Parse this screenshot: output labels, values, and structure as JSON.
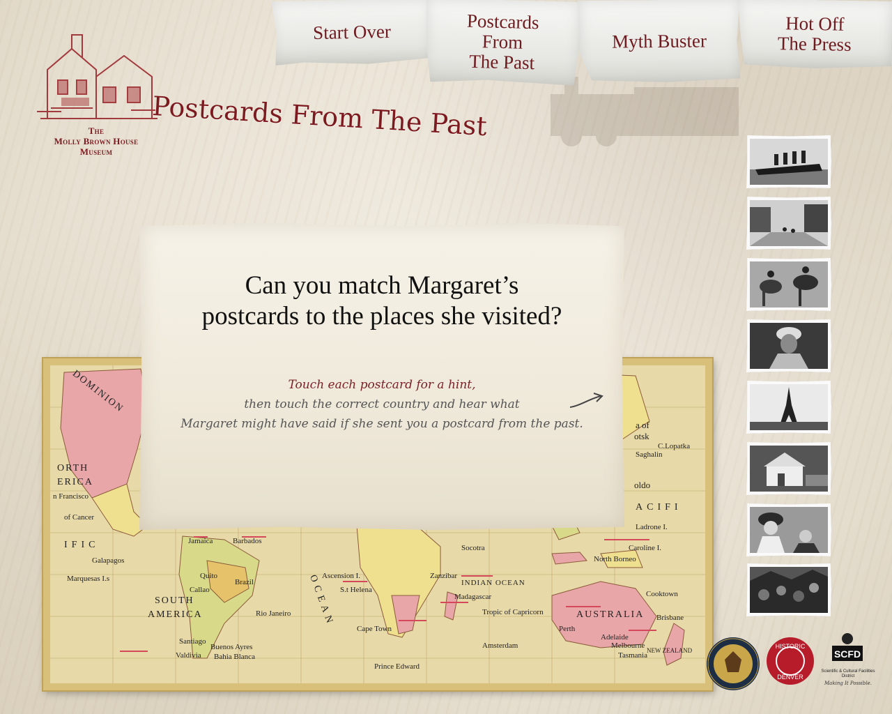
{
  "brand": {
    "line1": "The",
    "line2": "Molly Brown House",
    "line3": "Museum"
  },
  "nav": {
    "start_over": "Start Over",
    "postcards": "Postcards\nFrom\nThe Past",
    "myth_buster": "Myth Buster",
    "hot_off": "Hot Off\nThe Press"
  },
  "page_title": "Postcards From The Past",
  "card": {
    "question_line1": "Can you match Margaret’s",
    "question_line2": "postcards to the places she visited?",
    "hint_line1": "Touch each postcard for a hint,",
    "hint_line2": "then touch the correct country and hear what",
    "hint_line3": "Margaret might have said if she sent you a postcard from the past."
  },
  "map_labels": {
    "dominion": "DOMINION",
    "north_america_1": "ORTH",
    "north_america_2": "ERICA",
    "san_francisco": "n Francisco",
    "cancer": "of Cancer",
    "pacific_left": "IFIC",
    "galapagos": "Galapagos",
    "marquesas": "Marquesas I.s",
    "south_america_1": "SOUTH",
    "south_america_2": "AMERICA",
    "brazil": "Brazil",
    "atlantic": "OCEAN",
    "indian_ocean": "INDIAN OCEAN",
    "madagascar": "Madagascar",
    "australia": "AUSTRALIA",
    "pacific_right": "ACIFI",
    "ladrone": "Ladrone I.",
    "caroline": "Caroline I.",
    "north_borneo": "North Borneo",
    "perth": "Perth",
    "adelaide": "Adelaide",
    "melbourne": "Melbourne",
    "tasmania": "Tasmania",
    "new_zealand": "NEW ZEALAND",
    "capricorn": "Tropic of Capricorn",
    "cape_town": "Cape Town",
    "rio": "Rio Janeiro",
    "buenos_aires": "Buenos Ayres",
    "barbados": "Barbados",
    "jamaica": "Jamaica",
    "st_helena": "S.t Helena",
    "ascension": "Ascension I.",
    "sea_of": "a of",
    "otsk": "otsk",
    "sagalin": "Saghalin",
    "lopatka": "C.Lopatka",
    "oldo": "oldo",
    "cookstown": "Cooktown",
    "brisbane": "Brisbane",
    "valdivia": "Valdivia",
    "santiago": "Santiago",
    "callao": "Callao",
    "quito": "Quito",
    "bahia": "Bahia Blanca",
    "prince_edward": "Prince Edward",
    "amsterdam": "Amsterdam",
    "socotra": "Socotra",
    "zanzibar": "Zanzibar"
  },
  "thumbnails": [
    {
      "name": "ship"
    },
    {
      "name": "street"
    },
    {
      "name": "camels"
    },
    {
      "name": "portrait"
    },
    {
      "name": "eiffel-tower"
    },
    {
      "name": "house"
    },
    {
      "name": "women"
    },
    {
      "name": "crowd"
    }
  ],
  "sponsors": {
    "neh": "National Endowment for the Humanities",
    "historic_denver_1": "HISTORIC",
    "historic_denver_2": "DENVER",
    "scfd": "SCFD",
    "scfd_full": "Scientific & Cultural Facilities District",
    "scfd_tag": "Making It Possible."
  },
  "colors": {
    "maroon": "#7d1a20",
    "paper": "#f6f2e8",
    "map_land_pink": "#e9a6a8",
    "map_land_yellow": "#efe08f",
    "map_sea": "#e8d9a8"
  }
}
